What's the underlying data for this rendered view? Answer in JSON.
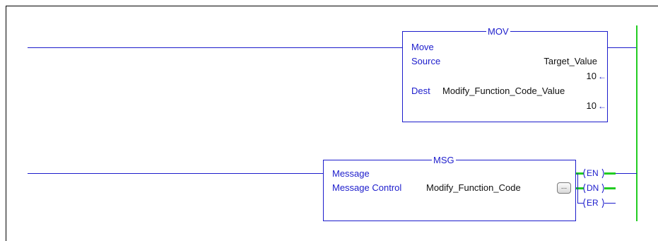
{
  "mov": {
    "title": "MOV",
    "name": "Move",
    "source_label": "Source",
    "source_tag": "Target_Value",
    "source_value": "10",
    "dest_label": "Dest",
    "dest_tag": "Modify_Function_Code_Value",
    "dest_value": "10",
    "value_arrow": "←"
  },
  "msg": {
    "title": "MSG",
    "name": "Message",
    "control_label": "Message Control",
    "control_tag": "Modify_Function_Code",
    "browse_label": "...",
    "outputs": [
      {
        "label": "EN",
        "energized": true
      },
      {
        "label": "DN",
        "energized": true
      },
      {
        "label": "ER",
        "energized": false
      }
    ]
  },
  "colors": {
    "wire": "#1c1ccc",
    "energized": "#22cc22",
    "frame": "#000000"
  }
}
